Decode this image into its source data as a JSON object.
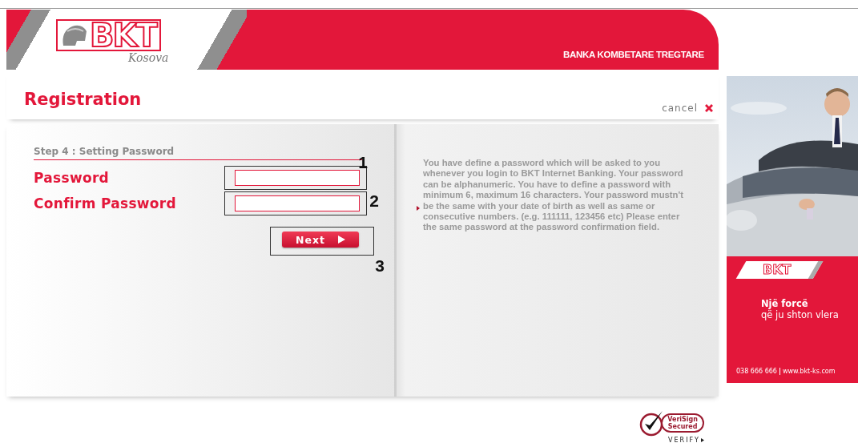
{
  "header": {
    "logo": {
      "mark": "BKT",
      "region": "Kosova"
    },
    "tagline": "BANKA KOMBETARE TREGTARE"
  },
  "page_title": "Registration",
  "cancel": {
    "label": "cancel"
  },
  "step": "Step 4 : Setting Password",
  "fields": [
    {
      "label": "Password",
      "annotation": "1"
    },
    {
      "label": "Confirm Password",
      "annotation": "2"
    }
  ],
  "next_button": {
    "label": "Next",
    "annotation": "3"
  },
  "help_text": "You have define a password which will be asked to you whenever you login to BKT Internet Banking. Your password can be alphanumeric. You have to define a password with minimum 6, maximum 16 characters. Your password mustn't be the same with your date of birth as well as same or consecutive numbers. (e.g. 111111, 123456 etc) Please enter the same password at the password confirmation field.",
  "ad": {
    "logo": "BKT",
    "headline": "Një forcë",
    "subline": "që ju shton vlera",
    "phone": "038 666 666",
    "website": "www.bkt-ks.com"
  },
  "badge": {
    "name": "VeriSign",
    "line2": "Secured",
    "verify": "VERIFY"
  }
}
